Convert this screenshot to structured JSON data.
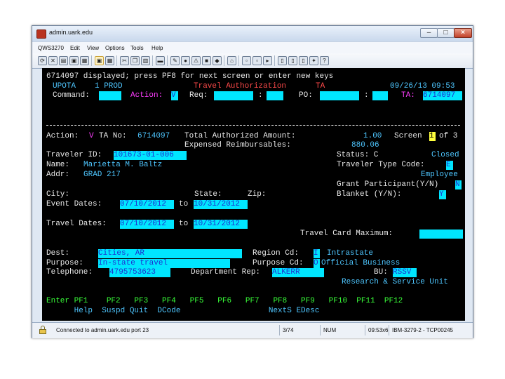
{
  "window": {
    "title": "admin.uark.edu"
  },
  "menu": [
    "QWS3270",
    "Edit",
    "View",
    "Options",
    "Tools",
    "Help"
  ],
  "toolbar_icons": [
    "connect-icon",
    "disconnect-icon",
    "print-icon",
    "save-icon",
    "copy-screen-icon",
    "display-icon",
    "cut-icon",
    "copy-icon",
    "paste-icon",
    "keyboard-icon",
    "settings-icon",
    "warning-icon",
    "stop-icon",
    "macro-icon",
    "home-icon",
    "screen1-icon",
    "screen2-icon",
    "screen3-icon",
    "screen4-icon",
    "screen5-icon",
    "plugin-icon",
    "help-icon"
  ],
  "screen": {
    "msg": "6714097 displayed; press PF8 for next screen or enter new keys",
    "sys": "UPOTA",
    "prod": "1 PROD",
    "app_title": "Travel Authorization",
    "app_code": "TA",
    "datetime": "09/26/13 09:53",
    "command_label": "Command:",
    "action_label": "Action:",
    "action_val": "V",
    "req_label": "Req:",
    "req_sep": ":",
    "po_label": "PO:",
    "po_sep": ":",
    "ta_label": "TA:",
    "ta_val": "6714097",
    "action_line_label": "Action:",
    "action_line_val": "V",
    "ta_no_label": "TA No:",
    "ta_no": "6714097",
    "total_label": "Total Authorized Amount:",
    "total_val": "1.00",
    "screen_label": "Screen",
    "screen_cur": "1",
    "screen_of": "of 3",
    "expensed_label": "Expensed Reimbursables:",
    "expensed_val": "880.06",
    "traveler_label": "Traveler ID:",
    "traveler_id": "101673-01-006",
    "status_label": "Status: C",
    "status_val": "Closed",
    "name_label": "Name:",
    "name_val": "Marietta M. Baltz",
    "ttype_label": "Traveler Type Code:",
    "ttype_val": "E",
    "addr_label": "Addr:",
    "addr_val": "GRAD 217",
    "employee": "Employee",
    "grant_label": "Grant Participant(Y/N)",
    "grant_val": "N",
    "city_label": "City:",
    "state_label": "State:",
    "zip_label": "Zip:",
    "blanket_label": "Blanket (Y/N):",
    "blanket_val": "Y",
    "event_label": "Event Dates:",
    "event_from": "07/10/2012",
    "to_word": "to",
    "event_to": "10/31/2012",
    "travel_label": "Travel Dates:",
    "travel_from": "07/10/2012",
    "travel_to": "10/31/2012",
    "card_label": "Travel Card Maximum:",
    "dest_label": "Dest:",
    "dest_val": "Cities, AR",
    "region_label": "Region Cd:",
    "region_cd": "I",
    "region_val": "Intrastate",
    "purpose_label": "Purpose:",
    "purpose_val": "In-state travel",
    "purpose_cd_label": "Purpose Cd:",
    "purpose_cd": "O",
    "purpose_cd_val": "Official Business",
    "tel_label": "Telephone:",
    "tel_val": "4795753623",
    "dept_label": "Department Rep:",
    "dept_val": "ALKERR",
    "bu_label": "BU:",
    "bu_val": "RSSV",
    "bu_name": "Research & Service Unit",
    "pf_row": "Enter PF1    PF2   PF3   PF4   PF5   PF6   PF7   PF8   PF9   PF10  PF11  PF12",
    "pf_desc": "      Help  Suspd Quit  DCode                   NextS EDesc"
  },
  "status": {
    "connected": "Connected to admin.uark.edu port 23",
    "position": "3/74",
    "num": "NUM",
    "cursor": "09:53x6",
    "model": "IBM-3279-2 - TCP00245"
  },
  "colors": {
    "screen_bg": "#000000",
    "field_bg": "#00e6ff",
    "label_white": "#e8e8e8",
    "label_green": "#39ff39",
    "label_blue": "#4ec6ff",
    "label_magenta": "#ff3dff",
    "label_red": "#ff4a4a",
    "highlight_yellow": "#ffff3d"
  }
}
